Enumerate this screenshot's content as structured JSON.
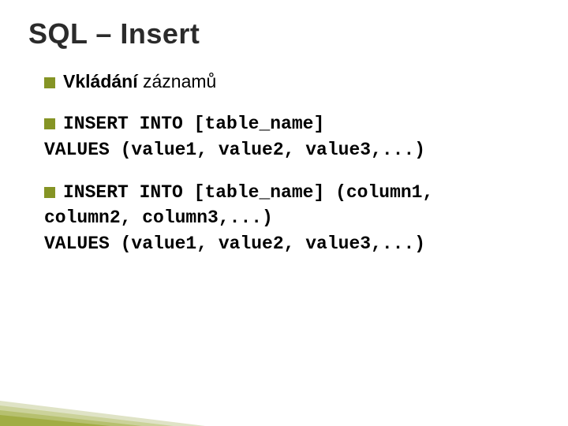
{
  "title": "SQL – Insert",
  "items": [
    {
      "lead_bold": "Vkládání",
      "lead_rest": " záznamů",
      "mono_lines": []
    },
    {
      "lead_bold": "INSERT",
      "lead_rest": "",
      "mono_lines": [
        " INTO [table_name]",
        "VALUES (value1, value2, value3,...)"
      ]
    },
    {
      "lead_bold": "INSERT",
      "lead_rest": "",
      "mono_lines": [
        " INTO [table_name] (column1,",
        "column2, column3,...)",
        "VALUES (value1, value2, value3,...)"
      ]
    }
  ]
}
